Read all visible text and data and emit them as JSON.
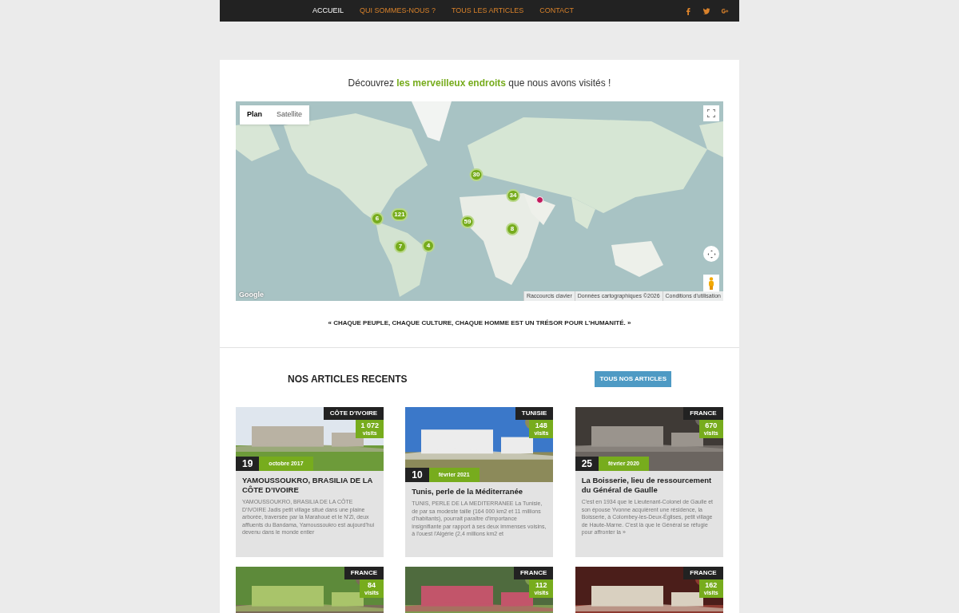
{
  "nav": {
    "items": [
      {
        "label": "ACCUEIL",
        "selected": true
      },
      {
        "label": "QUI SOMMES-NOUS ?",
        "selected": false
      },
      {
        "label": "TOUS LES ARTICLES",
        "selected": false
      },
      {
        "label": "CONTACT",
        "selected": false
      }
    ]
  },
  "intro": {
    "before": "Découvrez ",
    "highlight": "les merveilleux endroits",
    "after": " que nous avons visités !"
  },
  "map": {
    "map_types": [
      {
        "label": "Plan",
        "selected": true
      },
      {
        "label": "Satellite",
        "selected": false
      }
    ],
    "clusters": [
      "30",
      "34",
      "121",
      "6",
      "59",
      "8",
      "7",
      "4"
    ],
    "logo": "Google",
    "attribution": [
      "Raccourcis clavier",
      "Données cartographiques ©2026",
      "Conditions d'utilisation"
    ]
  },
  "quote": "« CHAQUE PEUPLE, CHAQUE CULTURE, CHAQUE HOMME EST UN TRÉSOR POUR L’HUMANITÉ. »",
  "section_title": "NOS ARTICLES RECENTS",
  "all_articles_button": "TOUS NOS ARTICLES",
  "articles": [
    {
      "country": "CÔTE D'IVOIRE",
      "visits": "1 072",
      "visits_label": "visits",
      "day": "19",
      "month": "octobre 2017",
      "title": "YAMOUSSOUKRO, BRASILIA DE LA CÔTE D’IVOIRE",
      "excerpt": "YAMOUSSOUKRO, BRASILIA DE LA CÔTE D'IVOIRE Jadis petit village situé dans une plaine arborée, traversée par la Marahoué et le N'Zi, deux affluents du Bandama, Yamoussoukro est aujourd'hui devenu dans le monde entier"
    },
    {
      "country": "TUNISIE",
      "visits": "148",
      "visits_label": "visits",
      "day": "10",
      "month": "février 2021",
      "title": "Tunis, perle de la Méditerranée",
      "excerpt": "TUNIS, PERLE DE LA MEDITERRANEE La Tunisie, de par sa modeste taille (164 000 km2 et 11 millions d'habitants), pourrait paraître d'importance insignifiante par rapport à ses deux immenses voisins, à l'ouest l'Algérie (2,4 millions km2 et"
    },
    {
      "country": "FRANCE",
      "visits": "670",
      "visits_label": "visits",
      "day": "25",
      "month": "février 2020",
      "title": "La Boisserie, lieu de ressourcement du Général de Gaulle",
      "excerpt": "C'est en 1934 que le Lieutenant-Colonel de Gaulle et son épouse Yvonne acquièrent une résidence, la Boisserie, à Colombey-les-Deux-Églises, petit village de Haute-Marne. C'est là que le Général se réfugie pour affronter la »"
    },
    {
      "country": "FRANCE",
      "visits": "84",
      "visits_label": "visits"
    },
    {
      "country": "FRANCE",
      "visits": "112",
      "visits_label": "visits"
    },
    {
      "country": "FRANCE",
      "visits": "162",
      "visits_label": "visits"
    }
  ]
}
